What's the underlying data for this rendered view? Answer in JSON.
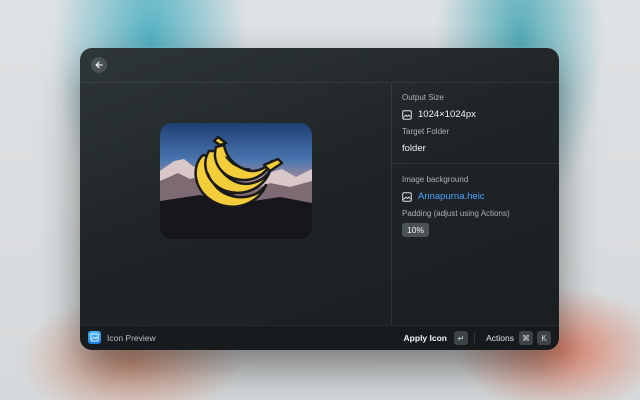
{
  "window": {
    "back_icon": "arrow-left-icon"
  },
  "details": {
    "output_size": {
      "label": "Output Size",
      "value": "1024×1024px",
      "icon": "image-icon"
    },
    "target_folder": {
      "label": "Target Folder",
      "value": "folder"
    },
    "image_background": {
      "label": "Image background",
      "value": "Annapurna.heic",
      "icon": "image-icon"
    },
    "padding": {
      "label": "Padding (adjust using Actions)",
      "value": "10%"
    }
  },
  "footer": {
    "title": "Icon Preview",
    "apply_label": "Apply Icon",
    "apply_key": "↵",
    "actions_label": "Actions",
    "actions_keys": [
      "⌘",
      "K"
    ]
  },
  "colors": {
    "accent_link": "#4aa3ff",
    "window_bg": "#1f2527",
    "banana": "#f4cd3a"
  }
}
